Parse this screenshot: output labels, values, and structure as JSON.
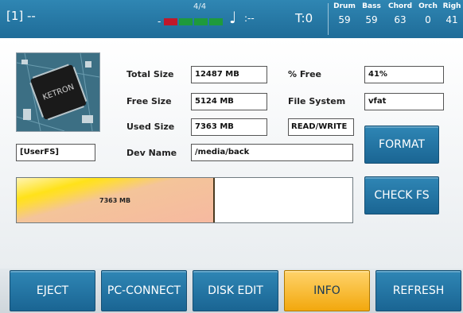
{
  "topbar": {
    "slot": "[1] --",
    "beat_label": "4/4",
    "beat_dash": "-",
    "tempo": ":--",
    "transpose": "T:0",
    "tracks": [
      {
        "name": "Drum",
        "value": "59"
      },
      {
        "name": "Bass",
        "value": "59"
      },
      {
        "name": "Chord",
        "value": "63"
      },
      {
        "name": "Orch",
        "value": "0"
      },
      {
        "name": "Righ",
        "value": "41"
      }
    ],
    "colors": {
      "bar": "#1f6c98",
      "beat_red": "#c0182a",
      "beat_green": "#1e9a3c"
    }
  },
  "device": {
    "name_value": "[UserFS]",
    "chip_text": "KETRON"
  },
  "info": {
    "total_size_label": "Total Size",
    "total_size_value": "12487 MB",
    "free_size_label": "Free Size",
    "free_size_value": "5124 MB",
    "used_size_label": "Used Size",
    "used_size_value": "7363 MB",
    "dev_name_label": "Dev Name",
    "dev_name_value": "/media/back",
    "percent_free_label": "% Free",
    "percent_free_value": "41%",
    "file_system_label": "File System",
    "file_system_value": "vfat",
    "mode_value": "READ/WRITE"
  },
  "usage": {
    "used_text": "7363 MB",
    "used_fraction": 0.59
  },
  "side_buttons": {
    "format": "FORMAT",
    "check_fs": "CHECK FS"
  },
  "bottom_buttons": [
    {
      "label": "EJECT",
      "active": false
    },
    {
      "label": "PC-CONNECT",
      "active": false
    },
    {
      "label": "DISK EDIT",
      "active": false
    },
    {
      "label": "INFO",
      "active": true
    },
    {
      "label": "REFRESH",
      "active": false
    }
  ]
}
